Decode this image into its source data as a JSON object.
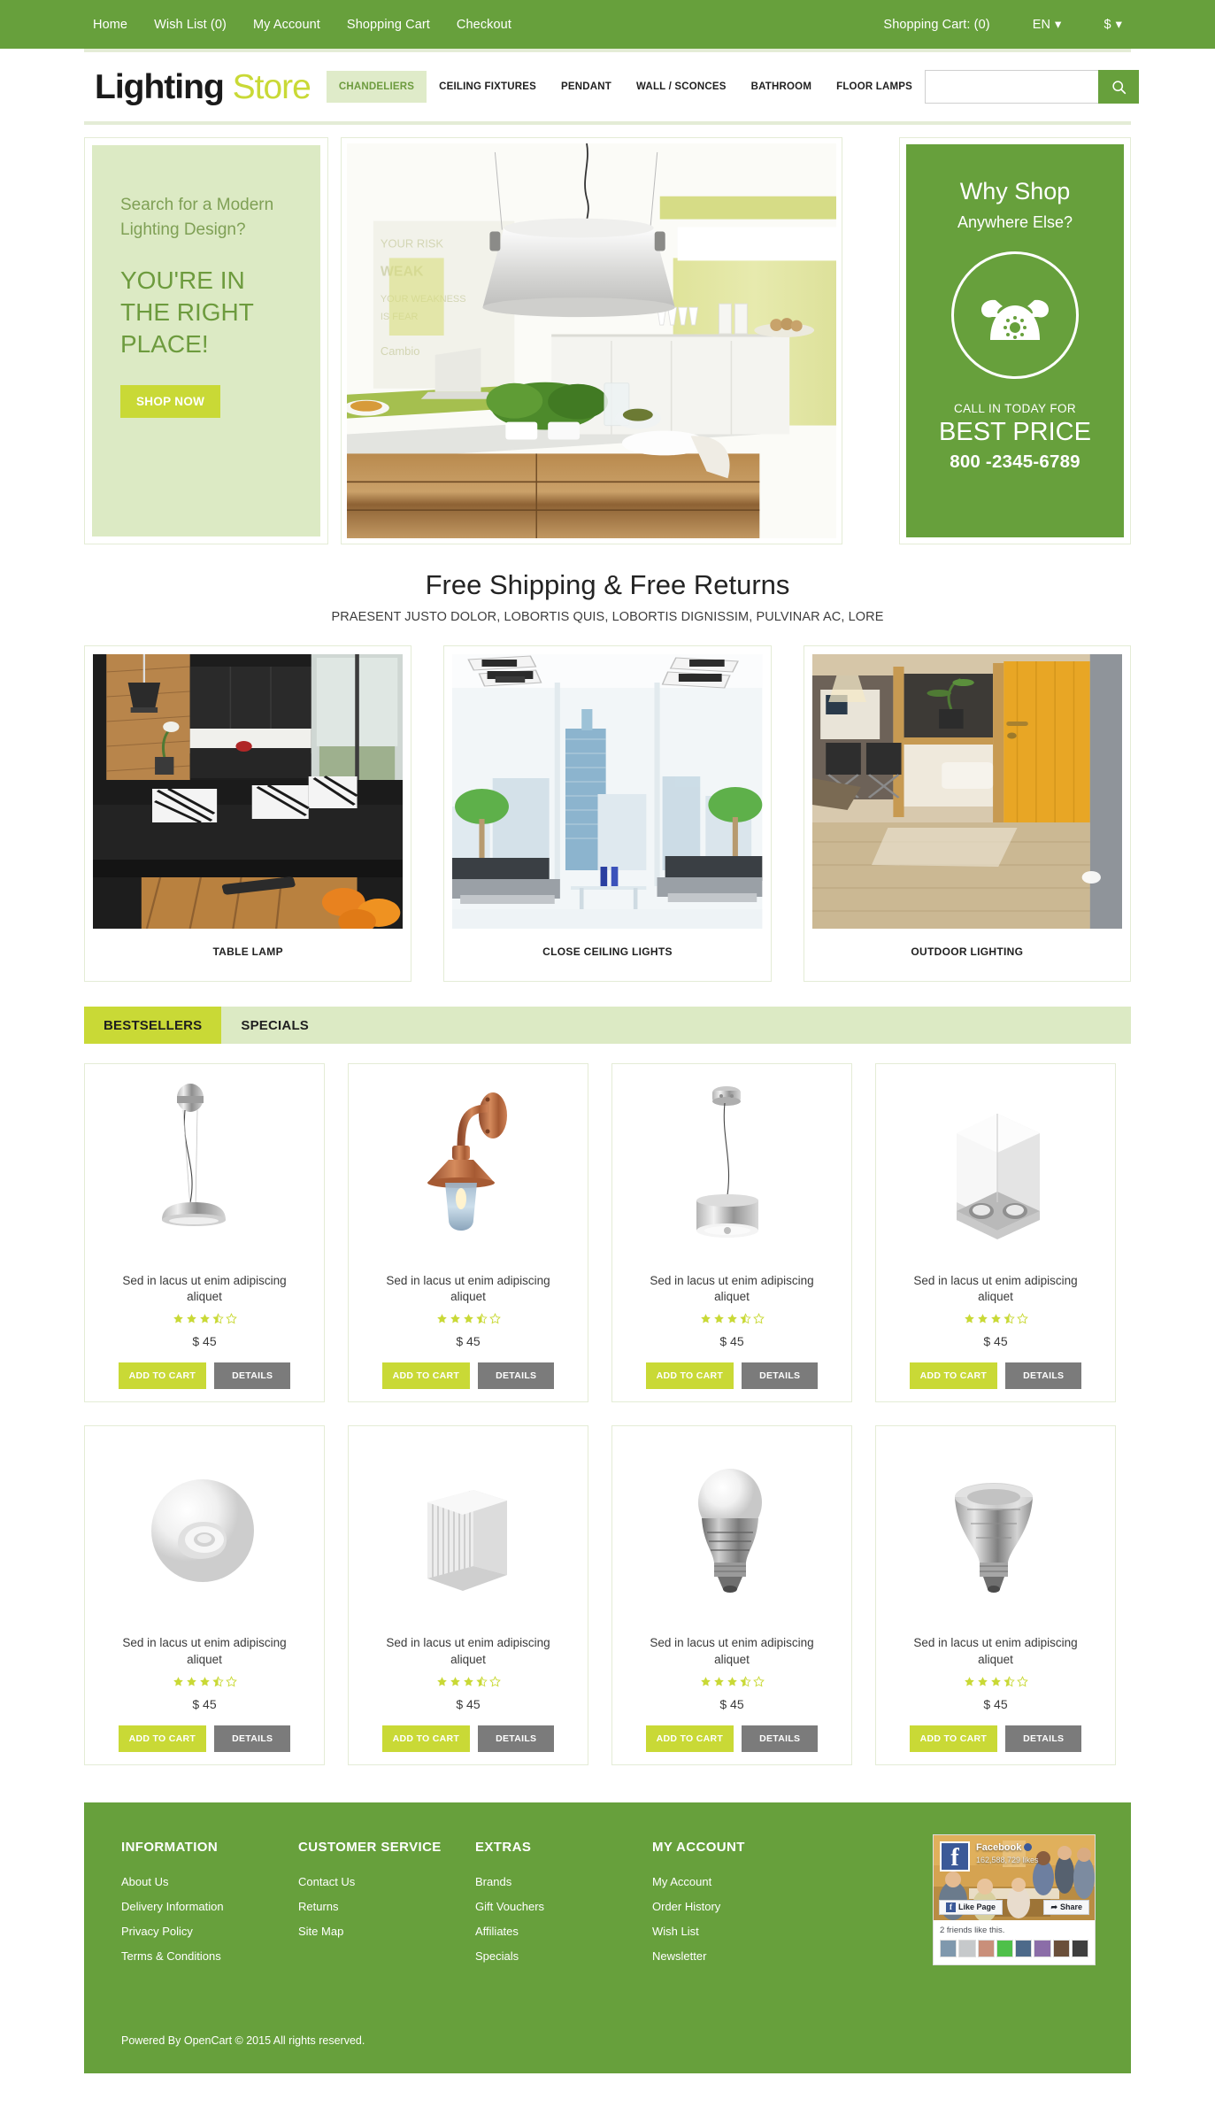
{
  "topbar": {
    "left_links": [
      {
        "label": "Home",
        "name": "home"
      },
      {
        "label": "Wish List (0)",
        "name": "wish-list"
      },
      {
        "label": "My Account",
        "name": "my-account"
      },
      {
        "label": "Shopping Cart",
        "name": "shopping-cart"
      },
      {
        "label": "Checkout",
        "name": "checkout"
      }
    ],
    "cart_status": "Shopping Cart: (0)",
    "language": "EN",
    "currency": "$"
  },
  "header": {
    "logo_bold": "Lighting",
    "logo_light": "Store",
    "nav": [
      {
        "label": "CHANDELIERS",
        "active": true
      },
      {
        "label": "CEILING FIXTURES",
        "active": false
      },
      {
        "label": "PENDANT",
        "active": false
      },
      {
        "label": "WALL / SCONCES",
        "active": false
      },
      {
        "label": "BATHROOM",
        "active": false
      },
      {
        "label": "FLOOR LAMPS",
        "active": false
      }
    ],
    "search_value": "",
    "search_placeholder": ""
  },
  "hero": {
    "left": {
      "question": "Search for a Modern Lighting Design?",
      "headline": "YOU'RE IN THE RIGHT PLACE!",
      "button": "SHOP NOW"
    },
    "right": {
      "line1": "Why Shop",
      "line2": "Anywhere Else?",
      "line3": "CALL IN TODAY FOR",
      "line4": "BEST PRICE",
      "phone": "800 -2345-6789",
      "icon": "telephone-icon"
    }
  },
  "promo": {
    "heading": "Free Shipping & Free Returns",
    "subheading": "PRAESENT JUSTO DOLOR, LOBORTIS QUIS, LOBORTIS DIGNISSIM, PULVINAR AC, LORE"
  },
  "categories": [
    {
      "label": "TABLE LAMP"
    },
    {
      "label": "CLOSE CEILING LIGHTS"
    },
    {
      "label": "OUTDOOR LIGHTING"
    }
  ],
  "tabs": [
    {
      "label": "BESTSELLERS",
      "active": true
    },
    {
      "label": "SPECIALS",
      "active": false
    }
  ],
  "products": [
    {
      "name": "Sed in lacus ut enim adipiscing aliquet",
      "price": "$ 45",
      "rating": 3.5,
      "add_label": "ADD TO CART",
      "details_label": "DETAILS",
      "image": "pendant-dome-lamp"
    },
    {
      "name": "Sed in lacus ut enim adipiscing aliquet",
      "price": "$ 45",
      "rating": 3.5,
      "add_label": "ADD TO CART",
      "details_label": "DETAILS",
      "image": "copper-wall-sconce"
    },
    {
      "name": "Sed in lacus ut enim adipiscing aliquet",
      "price": "$ 45",
      "rating": 3.5,
      "add_label": "ADD TO CART",
      "details_label": "DETAILS",
      "image": "drum-pendant-lamp"
    },
    {
      "name": "Sed in lacus ut enim adipiscing aliquet",
      "price": "$ 45",
      "rating": 3.5,
      "add_label": "ADD TO CART",
      "details_label": "DETAILS",
      "image": "double-box-spotlight"
    },
    {
      "name": "Sed in lacus ut enim adipiscing aliquet",
      "price": "$ 45",
      "rating": 3.5,
      "add_label": "ADD TO CART",
      "details_label": "DETAILS",
      "image": "round-wall-light"
    },
    {
      "name": "Sed in lacus ut enim adipiscing aliquet",
      "price": "$ 45",
      "rating": 3.5,
      "add_label": "ADD TO CART",
      "details_label": "DETAILS",
      "image": "finned-wall-light"
    },
    {
      "name": "Sed in lacus ut enim adipiscing aliquet",
      "price": "$ 45",
      "rating": 3.5,
      "add_label": "ADD TO CART",
      "details_label": "DETAILS",
      "image": "led-bulb"
    },
    {
      "name": "Sed in lacus ut enim adipiscing aliquet",
      "price": "$ 45",
      "rating": 3.5,
      "add_label": "ADD TO CART",
      "details_label": "DETAILS",
      "image": "par-reflector-bulb"
    }
  ],
  "footer": {
    "columns": [
      {
        "title": "INFORMATION",
        "links": [
          "About Us",
          "Delivery Information",
          "Privacy Policy",
          "Terms & Conditions"
        ]
      },
      {
        "title": "CUSTOMER SERVICE",
        "links": [
          "Contact Us",
          "Returns",
          "Site Map"
        ]
      },
      {
        "title": "EXTRAS",
        "links": [
          "Brands",
          "Gift Vouchers",
          "Affiliates",
          "Specials"
        ]
      },
      {
        "title": "MY ACCOUNT",
        "links": [
          "My Account",
          "Order History",
          "Wish List",
          "Newsletter"
        ]
      }
    ],
    "facebook": {
      "page_name": "Facebook",
      "likes": "162,588,729 likes",
      "like_button": "Like Page",
      "share_button": "Share",
      "friends": "2 friends like this."
    },
    "copyright": "Powered By OpenCart © 2015 All rights reserved."
  },
  "colors": {
    "green": "#67a03c",
    "lime": "#c9d936",
    "pale_green": "#dceac4",
    "border_green": "#e4ecd6",
    "gray_button": "#7b7b7b"
  }
}
